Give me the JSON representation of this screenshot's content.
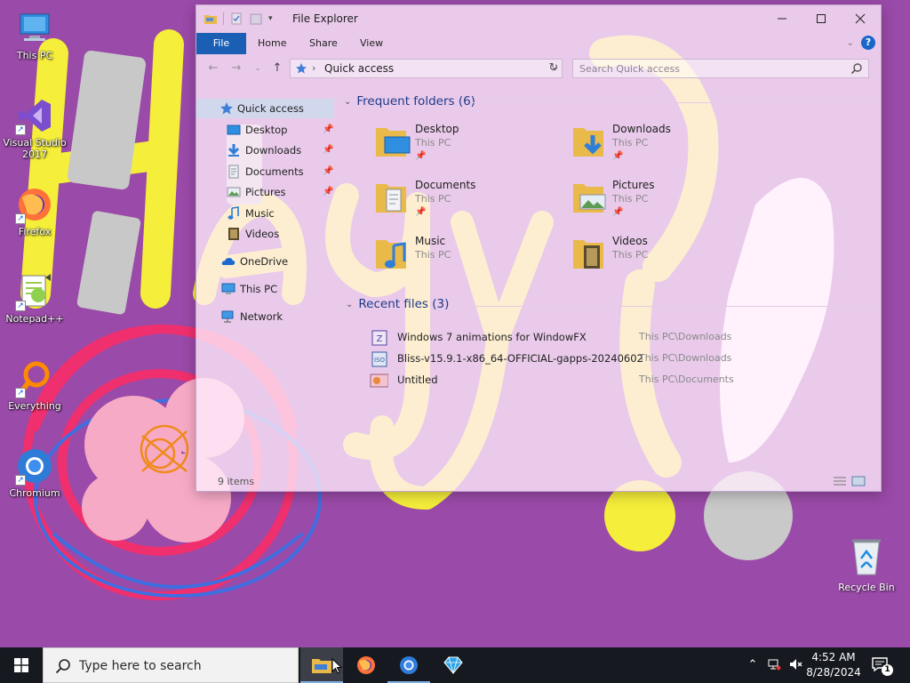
{
  "desktop": {
    "icons": [
      {
        "label": "This PC",
        "icon": "this-pc-icon"
      },
      {
        "label": "Visual Studio 2017",
        "icon": "visual-studio-icon"
      },
      {
        "label": "Firefox",
        "icon": "firefox-icon"
      },
      {
        "label": "Notepad++",
        "icon": "notepadpp-icon"
      },
      {
        "label": "Everything",
        "icon": "everything-search-icon"
      },
      {
        "label": "Chromium",
        "icon": "chromium-icon"
      }
    ],
    "recycle_bin": "Recycle Bin"
  },
  "explorer": {
    "title": "File Explorer",
    "ribbon_tabs": [
      "File",
      "Home",
      "Share",
      "View"
    ],
    "help": "?",
    "address": {
      "crumb": "Quick access"
    },
    "search": {
      "placeholder": "Search Quick access"
    },
    "nav": {
      "quick_access": "Quick access",
      "pinned": [
        {
          "label": "Desktop",
          "pinned": true
        },
        {
          "label": "Downloads",
          "pinned": true
        },
        {
          "label": "Documents",
          "pinned": true
        },
        {
          "label": "Pictures",
          "pinned": true
        },
        {
          "label": "Music",
          "pinned": false
        },
        {
          "label": "Videos",
          "pinned": false
        }
      ],
      "onedrive": "OneDrive",
      "this_pc": "This PC",
      "network": "Network"
    },
    "frequent": {
      "header": "Frequent folders (6)",
      "folders": [
        {
          "name": "Desktop",
          "location": "This PC",
          "pinned": true
        },
        {
          "name": "Downloads",
          "location": "This PC",
          "pinned": true
        },
        {
          "name": "Documents",
          "location": "This PC",
          "pinned": true
        },
        {
          "name": "Pictures",
          "location": "This PC",
          "pinned": true
        },
        {
          "name": "Music",
          "location": "This PC",
          "pinned": false
        },
        {
          "name": "Videos",
          "location": "This PC",
          "pinned": false
        }
      ]
    },
    "recent": {
      "header": "Recent files (3)",
      "files": [
        {
          "name": "Windows 7 animations for WindowFX",
          "path": "This PC\\Downloads"
        },
        {
          "name": "Bliss-v15.9.1-x86_64-OFFICIAL-gapps-20240602",
          "path": "This PC\\Downloads"
        },
        {
          "name": "Untitled",
          "path": "This PC\\Documents"
        }
      ]
    },
    "status": "9 items"
  },
  "taskbar": {
    "search_placeholder": "Type here to search",
    "time": "4:52 AM",
    "date": "8/28/2024",
    "notifications": "1"
  },
  "colors": {
    "wallpaper": "#9a4aa8",
    "accent": "#1a5fb4",
    "taskbar": "#16191f"
  }
}
